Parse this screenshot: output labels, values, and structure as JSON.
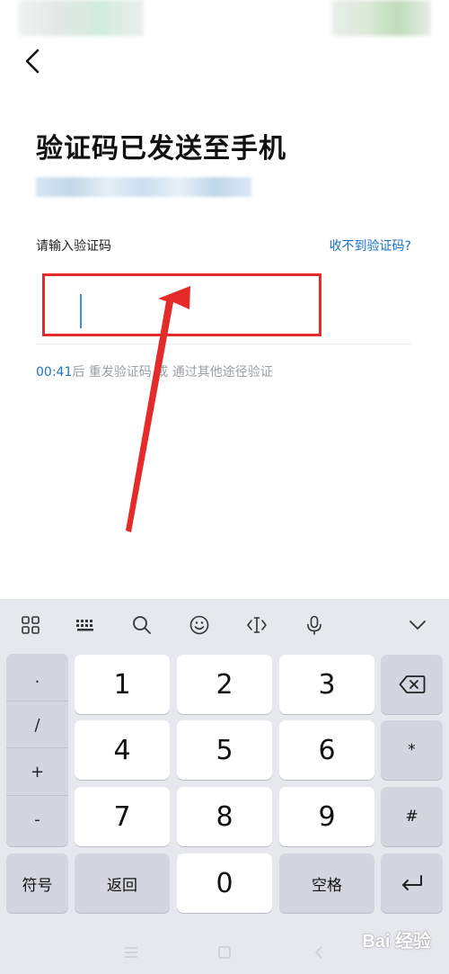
{
  "header": {
    "back_icon": "chevron-left-icon"
  },
  "page": {
    "title": "验证码已发送至手机",
    "input_label": "请输入验证码",
    "no_code_link": "收不到验证码?",
    "code_value": "",
    "resend": {
      "timer": "00:41",
      "suffix": "后 重发验证码 或",
      "alt_link": " 通过其他途径验证"
    }
  },
  "colors": {
    "accent": "#1a73c8",
    "highlight_box": "#e52a2a",
    "keyboard_bg": "#e6e8ee"
  },
  "keyboard": {
    "toolbar": [
      "grid-icon",
      "keyboard-icon",
      "search-icon",
      "emoji-icon",
      "cursor-icon",
      "microphone-icon",
      "chevron-down-icon"
    ],
    "symbols": [
      ".",
      "/",
      "+",
      "-"
    ],
    "digits": [
      "1",
      "2",
      "3",
      "4",
      "5",
      "6",
      "7",
      "8",
      "9",
      "0"
    ],
    "right_keys": {
      "star": "*",
      "hash": "#"
    },
    "bottom": {
      "symbols": "符号",
      "back": "返回",
      "space": "空格"
    }
  },
  "watermark": "Bai 经验"
}
